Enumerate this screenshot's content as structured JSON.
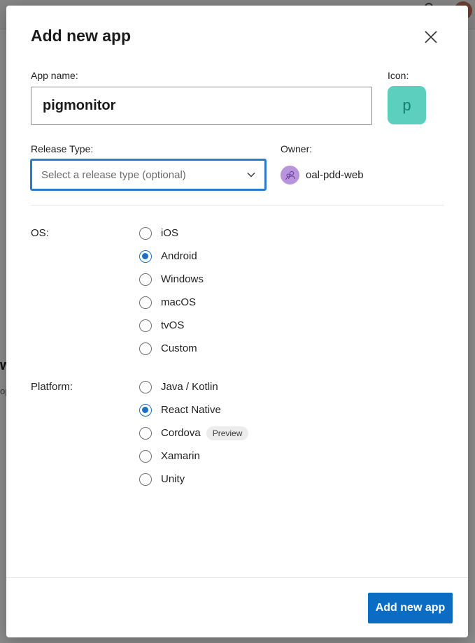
{
  "background": {
    "partial_heading": "w",
    "partial_text": "op"
  },
  "dialog": {
    "title": "Add new app",
    "close_icon": "close-icon",
    "app_name": {
      "label": "App name:",
      "value": "pigmonitor"
    },
    "icon": {
      "label": "Icon:",
      "letter": "p",
      "color": "#5dcfbe"
    },
    "release_type": {
      "label": "Release Type:",
      "placeholder": "Select a release type (optional)",
      "chevron_icon": "chevron-down-icon"
    },
    "owner": {
      "label": "Owner:",
      "name": "oal-pdd-web",
      "avatar_icon": "people-icon"
    },
    "os": {
      "label": "OS:",
      "options": [
        {
          "label": "iOS",
          "selected": false
        },
        {
          "label": "Android",
          "selected": true
        },
        {
          "label": "Windows",
          "selected": false
        },
        {
          "label": "macOS",
          "selected": false
        },
        {
          "label": "tvOS",
          "selected": false
        },
        {
          "label": "Custom",
          "selected": false
        }
      ]
    },
    "platform": {
      "label": "Platform:",
      "options": [
        {
          "label": "Java / Kotlin",
          "selected": false
        },
        {
          "label": "React Native",
          "selected": true
        },
        {
          "label": "Cordova",
          "selected": false,
          "badge": "Preview"
        },
        {
          "label": "Xamarin",
          "selected": false
        },
        {
          "label": "Unity",
          "selected": false
        }
      ]
    },
    "submit_label": "Add new app",
    "accent_color": "#0a6cc3"
  }
}
